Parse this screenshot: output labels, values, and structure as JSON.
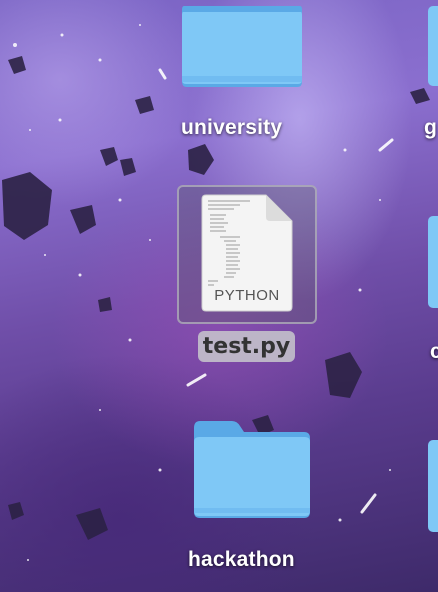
{
  "desktop": {
    "items": [
      {
        "id": "university",
        "label": "university",
        "type": "folder"
      },
      {
        "id": "test",
        "label": "test.py",
        "type": "python-file",
        "badge": "PYTHON",
        "selected": true
      },
      {
        "id": "hackathon",
        "label": "hackathon",
        "type": "folder"
      }
    ],
    "partial_labels": {
      "right_top": "g",
      "right_mid": "c"
    }
  },
  "colors": {
    "folder_front": "#7fc8f6",
    "folder_back": "#5aa9e6",
    "selection_bg": "#c8c8cd"
  }
}
